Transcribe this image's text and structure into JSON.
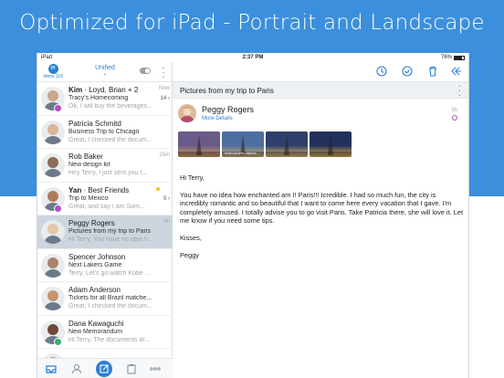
{
  "banner": {
    "title": "Optimized for iPad - Portrait and Landscape"
  },
  "status_bar": {
    "carrier": "iPad",
    "time": "2:37 PM",
    "battery": "76%"
  },
  "sidebar_header": {
    "inbox_label": "Inbox",
    "inbox_count": "118",
    "title": "Unified"
  },
  "mail_list": [
    {
      "sender_bold": "Kim",
      "sender_rest": " · Loyd, Brian + 2",
      "subject": "Tracy's Homecoming",
      "preview": "Ok, I will buy the beverages...",
      "time": "Now",
      "count": "14",
      "avatar_color": "#c9a98b"
    },
    {
      "sender_bold": "",
      "sender_rest": "Patricia Schmitd",
      "subject": "Business Trip to Chicago",
      "preview": "Great, I checked the docum...",
      "time": "",
      "count": "",
      "avatar_color": "#d8b49a"
    },
    {
      "sender_bold": "",
      "sender_rest": "Rob Baker",
      "subject": "New design kit",
      "preview": "Hey Terry, I just sent you t...",
      "time": "25m",
      "count": "",
      "avatar_color": "#8d6b57"
    },
    {
      "sender_bold": "Yan",
      "sender_rest": " · Best Friends",
      "subject": "Trip to Mexico",
      "preview": "Great, and say I am Som...",
      "time": "",
      "count": "5",
      "avatar_color": "#b07b5d"
    },
    {
      "sender_bold": "",
      "sender_rest": "Peggy Rogers",
      "subject": "Pictures from my trip to Paris",
      "preview": "Hi Terry, You have no idea h...",
      "time": "5h",
      "count": "",
      "avatar_color": "#e5c9a7"
    },
    {
      "sender_bold": "",
      "sender_rest": "Spencer Johnson",
      "subject": "Next Lakers Game",
      "preview": "Terry, Let's go watch Kobe ...",
      "time": "",
      "count": "",
      "avatar_color": "#a9826a"
    },
    {
      "sender_bold": "",
      "sender_rest": "Adam Anderson",
      "subject": "Tickets for all Brazil matche...",
      "preview": "Great, I checked the docum...",
      "time": "",
      "count": "",
      "avatar_color": "#c4956f"
    },
    {
      "sender_bold": "",
      "sender_rest": "Dana Kawaguchi",
      "subject": "New Memorandum",
      "preview": "Hi Terry, The documents ar...",
      "time": "",
      "count": "",
      "avatar_color": "#6e4a3b"
    },
    {
      "sender_bold": "",
      "sender_rest": "",
      "subject": "",
      "preview": "",
      "time": "",
      "count": "",
      "avatar_color": "#b8926f"
    }
  ],
  "email": {
    "subject": "Pictures from my trip to Paris",
    "sender": "Peggy Rogers",
    "more_details": "More Details",
    "time": "5h",
    "attachments": [
      {
        "label": "",
        "color_a": "#6a5a8a",
        "color_b": "#e0a15a"
      },
      {
        "label": "hotel-nearby-dance...",
        "color_a": "#4d6ea0",
        "color_b": "#d9b36b"
      },
      {
        "label": "",
        "color_a": "#2e3f6b",
        "color_b": "#f2c36a"
      },
      {
        "label": "",
        "color_a": "#22305c",
        "color_b": "#e8b94a"
      }
    ],
    "greeting": "Hi Terry,",
    "body": "You have no idea how enchanted am I! Paris!!! Icredible. I had so much fun, the city is incredibly romantic and so beautiful that I want to come here every vacation that I gave. I'm completely amused. I totally advise you to go visit Paris. Take Patricia there, she will love it. Let me know if you need some tips.",
    "closing": "Kisses,",
    "signature": "Peggy"
  },
  "colors": {
    "accent": "#2a7fd4",
    "banner": "#3c8fdc",
    "selected": "#cdd5de"
  },
  "icons": {
    "left_toolbar": [
      "inbox-icon",
      "contacts-icon",
      "compose-icon",
      "clipboard-icon",
      "more-horizontal-icon"
    ],
    "right_header": [
      "clock-icon",
      "check-circle-icon",
      "trash-icon",
      "reply-all-icon"
    ]
  }
}
